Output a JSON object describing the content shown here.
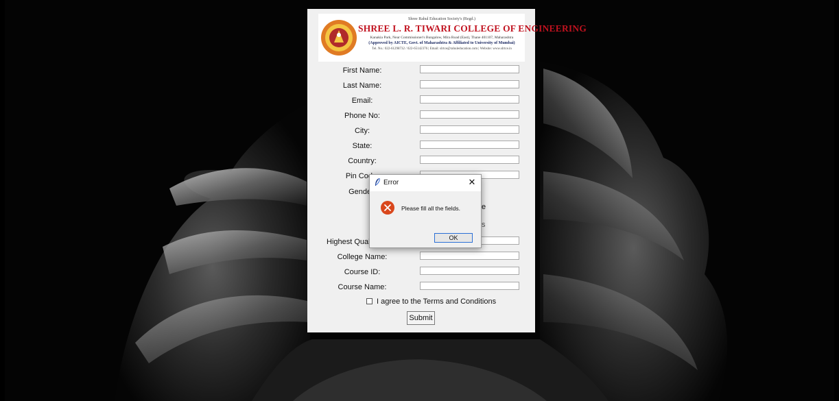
{
  "banner": {
    "society": "Shree Rahul Education Society's (Regd.)",
    "college": "SHREE L. R. TIWARI COLLEGE OF ENGINEERING",
    "address": "Kanakia Park, Near Commissioner's Bungalow, Mira Road (East), Thane 401107, Maharashtra",
    "approval": "(Approved by AICTE, Govt. of Maharashtra & Affiliated to University of Mumbai)",
    "contact": "Tel. No.: 022-61298732 / 022-65142376 | Email: slrtce@rahuleducation.com | Website: www.slrtce.in"
  },
  "form": {
    "fields": [
      {
        "label": "First Name:",
        "value": ""
      },
      {
        "label": "Last Name:",
        "value": ""
      },
      {
        "label": "Email:",
        "value": ""
      },
      {
        "label": "Phone No:",
        "value": ""
      },
      {
        "label": "City:",
        "value": ""
      },
      {
        "label": "State:",
        "value": ""
      },
      {
        "label": "Country:",
        "value": ""
      },
      {
        "label": "Pin Code:",
        "value": ""
      },
      {
        "label": "Gender:"
      },
      {
        "label": "Highest Qualification:",
        "value": ""
      },
      {
        "label": "College Name:",
        "value": ""
      },
      {
        "label": "Course ID:",
        "value": ""
      },
      {
        "label": "Course Name:",
        "value": ""
      }
    ],
    "terms_label": "I agree to the Terms and Conditions",
    "submit_label": "Submit"
  },
  "dialog": {
    "title": "Error",
    "close_glyph": "✕",
    "message": "Please fill all the fields.",
    "ok_label": "OK"
  }
}
